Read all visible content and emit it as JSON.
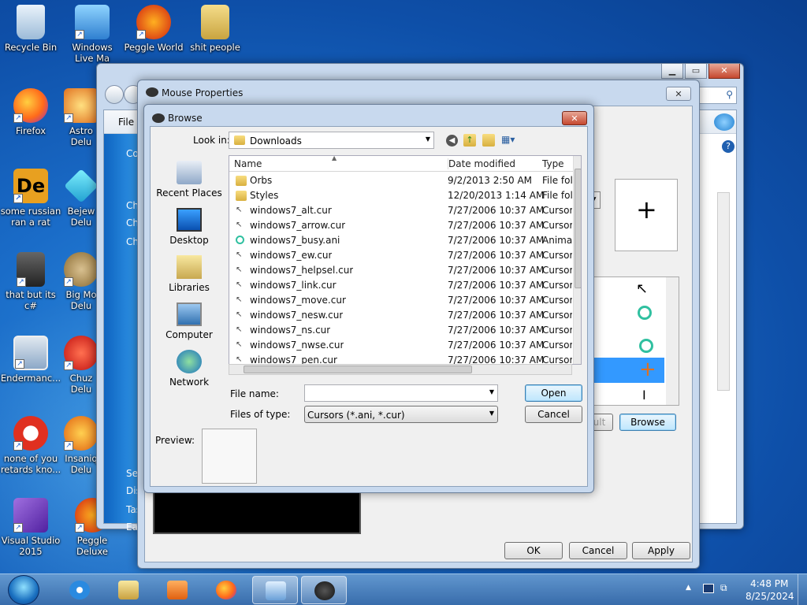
{
  "desktop": {
    "icons": [
      {
        "label": "Recycle Bin"
      },
      {
        "label": "Windows Live Ma"
      },
      {
        "label": "Peggle World"
      },
      {
        "label": "shit people"
      },
      {
        "label": "Firefox"
      },
      {
        "label": "Astro Delu"
      },
      {
        "label": "some russian ran a rat"
      },
      {
        "label": "Bejew Delu"
      },
      {
        "label": "that but its c#"
      },
      {
        "label": "Big Mo Delu"
      },
      {
        "label": "Endermanc..."
      },
      {
        "label": "Chuz Delu"
      },
      {
        "label": "none of you retards kno..."
      },
      {
        "label": "Insaniq Delu"
      },
      {
        "label": "Visual Studio 2015"
      },
      {
        "label": "Peggle Deluxe"
      }
    ]
  },
  "back_window": {
    "menu_file": "File",
    "side_frags": [
      "Co",
      "Ch",
      "Ch",
      "Ch",
      "See",
      "Dis",
      "Tas",
      "Eas"
    ]
  },
  "mouse_props": {
    "title": "Mouse Properties",
    "browse_button": "Browse",
    "default_button_frag": "ult",
    "ok": "OK",
    "cancel": "Cancel",
    "apply": "Apply"
  },
  "browse": {
    "title": "Browse",
    "look_in_label": "Look in:",
    "look_in_value": "Downloads",
    "nav": [
      "Recent Places",
      "Desktop",
      "Libraries",
      "Computer",
      "Network"
    ],
    "columns": {
      "name": "Name",
      "date": "Date modified",
      "type": "Type"
    },
    "files": [
      {
        "name": "Orbs",
        "date": "9/2/2013 2:50 AM",
        "type": "File fol",
        "kind": "folder"
      },
      {
        "name": "Styles",
        "date": "12/20/2013 1:14 AM",
        "type": "File fol",
        "kind": "folder"
      },
      {
        "name": "windows7_alt.cur",
        "date": "7/27/2006 10:37 AM",
        "type": "Cursor",
        "kind": "cur"
      },
      {
        "name": "windows7_arrow.cur",
        "date": "7/27/2006 10:37 AM",
        "type": "Cursor",
        "kind": "cur"
      },
      {
        "name": "windows7_busy.ani",
        "date": "7/27/2006 10:37 AM",
        "type": "Anima",
        "kind": "ani"
      },
      {
        "name": "windows7_ew.cur",
        "date": "7/27/2006 10:37 AM",
        "type": "Cursor",
        "kind": "cur"
      },
      {
        "name": "windows7_helpsel.cur",
        "date": "7/27/2006 10:37 AM",
        "type": "Cursor",
        "kind": "cur"
      },
      {
        "name": "windows7_link.cur",
        "date": "7/27/2006 10:37 AM",
        "type": "Cursor",
        "kind": "cur"
      },
      {
        "name": "windows7_move.cur",
        "date": "7/27/2006 10:37 AM",
        "type": "Cursor",
        "kind": "cur"
      },
      {
        "name": "windows7_nesw.cur",
        "date": "7/27/2006 10:37 AM",
        "type": "Cursor",
        "kind": "cur"
      },
      {
        "name": "windows7_ns.cur",
        "date": "7/27/2006 10:37 AM",
        "type": "Cursor",
        "kind": "cur"
      },
      {
        "name": "windows7_nwse.cur",
        "date": "7/27/2006 10:37 AM",
        "type": "Cursor",
        "kind": "cur"
      },
      {
        "name": "windows7_pen.cur",
        "date": "7/27/2006 10:37 AM",
        "type": "Cursor",
        "kind": "cur"
      }
    ],
    "file_name_label": "File name:",
    "file_name_value": "",
    "files_of_type_label": "Files of type:",
    "files_of_type_value": "Cursors (*.ani, *.cur)",
    "open": "Open",
    "cancel": "Cancel",
    "preview_label": "Preview:"
  },
  "taskbar": {
    "time": "4:48 PM",
    "date": "8/25/2024"
  },
  "colors": {
    "accent": "#3c7fb1",
    "close_red": "#c5482f",
    "selection": "#3399ff"
  }
}
